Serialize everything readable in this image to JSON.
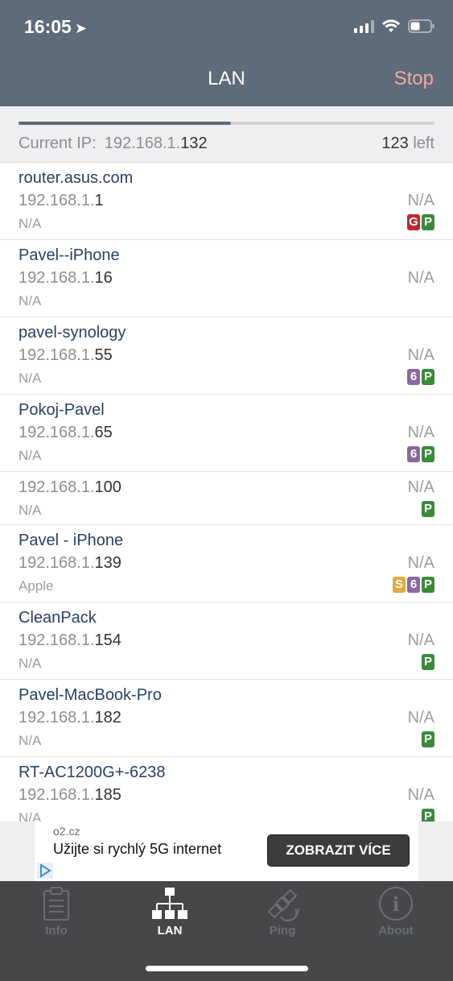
{
  "status_bar": {
    "time": "16:05",
    "location_icon": "location-arrow-icon"
  },
  "header": {
    "title": "LAN",
    "stop_label": "Stop"
  },
  "scan": {
    "progress": 0.51,
    "current_ip_label": "Current IP:",
    "current_ip_base": "192.168.1.",
    "current_ip_last": "132",
    "left_count": "123",
    "left_label": "left"
  },
  "devices": [
    {
      "name": "router.asus.com",
      "ip_base": "192.168.1.",
      "ip_last": "1",
      "vendor": "N/A",
      "na": "N/A",
      "badges": [
        "G",
        "P"
      ]
    },
    {
      "name": "Pavel--iPhone",
      "ip_base": "192.168.1.",
      "ip_last": "16",
      "vendor": "N/A",
      "na": "N/A",
      "badges": []
    },
    {
      "name": "pavel-synology",
      "ip_base": "192.168.1.",
      "ip_last": "55",
      "vendor": "N/A",
      "na": "N/A",
      "badges": [
        "6",
        "P"
      ]
    },
    {
      "name": "Pokoj-Pavel",
      "ip_base": "192.168.1.",
      "ip_last": "65",
      "vendor": "N/A",
      "na": "N/A",
      "badges": [
        "6",
        "P"
      ]
    },
    {
      "name": "",
      "ip_base": "192.168.1.",
      "ip_last": "100",
      "vendor": "N/A",
      "na": "N/A",
      "badges": [
        "P"
      ]
    },
    {
      "name": "Pavel - iPhone",
      "ip_base": "192.168.1.",
      "ip_last": "139",
      "vendor": "Apple",
      "na": "N/A",
      "badges": [
        "S",
        "6",
        "P"
      ]
    },
    {
      "name": "CleanPack",
      "ip_base": "192.168.1.",
      "ip_last": "154",
      "vendor": "N/A",
      "na": "N/A",
      "badges": [
        "P"
      ]
    },
    {
      "name": "Pavel-MacBook-Pro",
      "ip_base": "192.168.1.",
      "ip_last": "182",
      "vendor": "N/A",
      "na": "N/A",
      "badges": [
        "P"
      ]
    },
    {
      "name": "RT-AC1200G+-6238",
      "ip_base": "192.168.1.",
      "ip_last": "185",
      "vendor": "N/A",
      "na": "N/A",
      "badges": [
        "P"
      ]
    }
  ],
  "badge_colors": {
    "G": "#c0282d",
    "P": "#3a8a3a",
    "6": "#8a6a9e",
    "S": "#e3a93e"
  },
  "ad": {
    "domain": "o2.cz",
    "text": "Užijte si rychlý 5G internet",
    "button": "ZOBRAZIT VÍCE"
  },
  "tabs": [
    {
      "label": "Info",
      "icon": "clipboard-icon",
      "active": false
    },
    {
      "label": "LAN",
      "icon": "network-icon",
      "active": true
    },
    {
      "label": "Ping",
      "icon": "satellite-icon",
      "active": false
    },
    {
      "label": "About",
      "icon": "info-circle-icon",
      "active": false
    }
  ]
}
